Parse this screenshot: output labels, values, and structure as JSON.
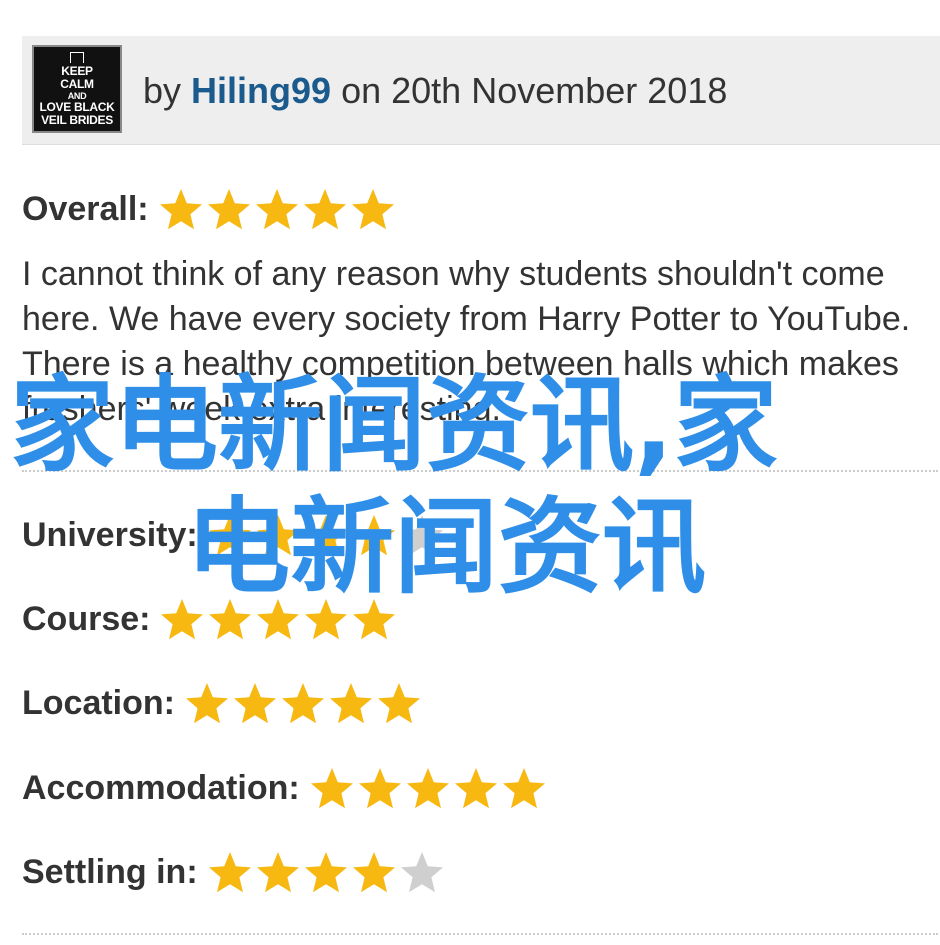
{
  "review": {
    "avatar_lines": [
      "KEEP",
      "CALM",
      "AND",
      "LOVE BLACK",
      "VEIL BRIDES"
    ],
    "by_prefix": "by",
    "author": "Hiling99",
    "date_text": "on 20th November 2018",
    "text": "I cannot think of any reason why students shouldn't come here. We have every society from Harry Potter to YouTube. There is a healthy competition between halls which makes freshers' week extra interesting."
  },
  "ratings": [
    {
      "label": "Overall:",
      "stars": 5,
      "max": 5
    },
    {
      "label": "University:",
      "stars": 4,
      "max": 5
    },
    {
      "label": "Course:",
      "stars": 5,
      "max": 5
    },
    {
      "label": "Location:",
      "stars": 5,
      "max": 5
    },
    {
      "label": "Accommodation:",
      "stars": 5,
      "max": 5
    },
    {
      "label": "Settling in:",
      "stars": 4,
      "max": 5
    }
  ],
  "watermark": {
    "line1": "家电新闻资讯,家",
    "line2": "电新闻资讯"
  },
  "colors": {
    "star_filled": "#f7b812",
    "star_empty": "#cfcfcf",
    "author": "#1a5a8c",
    "watermark": "#2f8fe8",
    "header_bg": "#eeeeee"
  }
}
